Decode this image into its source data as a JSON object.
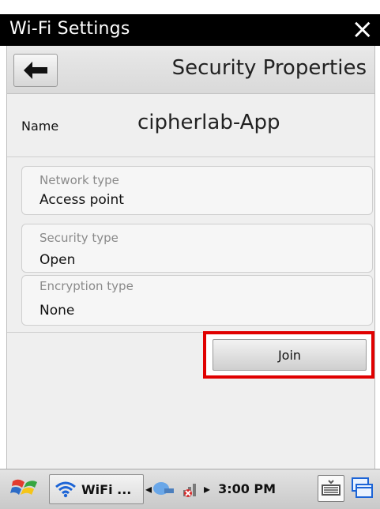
{
  "window": {
    "title": "Wi-Fi Settings",
    "close_icon": "×"
  },
  "header": {
    "title": "Security Properties",
    "back_icon": "arrow-left"
  },
  "network": {
    "name_label": "Name",
    "name_value": "cipherlab-App"
  },
  "fields": {
    "network_type": {
      "label": "Network type",
      "value": "Access point"
    },
    "security_type": {
      "label": "Security type",
      "value": "Open"
    },
    "encryption_type": {
      "label": "Encryption type",
      "value": "None"
    }
  },
  "actions": {
    "join_label": "Join"
  },
  "taskbar": {
    "task_label": "WiFi ...",
    "tray_left_symbol": "◂",
    "tray_right_symbol": "▸",
    "time": "3:00 PM"
  },
  "colors": {
    "highlight": "#e00000",
    "titlebar": "#000000"
  }
}
